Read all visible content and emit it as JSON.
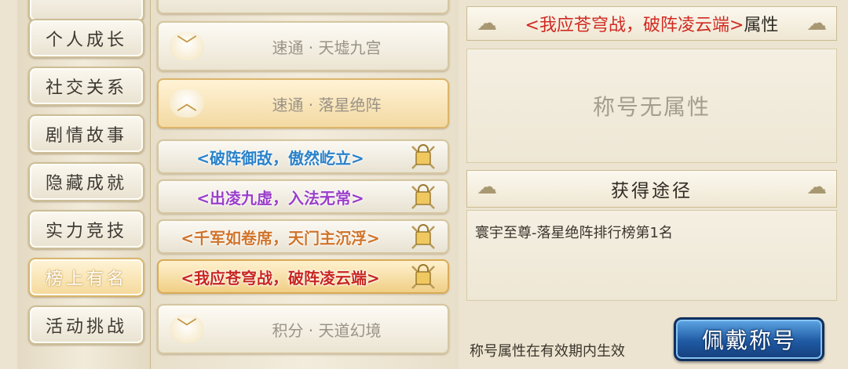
{
  "categories": [
    {
      "label": "个人成长",
      "active": false
    },
    {
      "label": "社交关系",
      "active": false
    },
    {
      "label": "剧情故事",
      "active": false
    },
    {
      "label": "隐藏成就",
      "active": false
    },
    {
      "label": "实力竞技",
      "active": false
    },
    {
      "label": "榜上有名",
      "active": true
    },
    {
      "label": "活动挑战",
      "active": false
    }
  ],
  "groups": [
    {
      "label": "速通 · 天墟九宫",
      "expanded": false
    },
    {
      "label": "速通 · 落星绝阵",
      "expanded": true
    },
    {
      "label": "积分 · 天道幻境",
      "expanded": false
    }
  ],
  "titles": [
    {
      "text": "<破阵御敌，傲然屹立>",
      "color": "#2a82c9",
      "selected": false
    },
    {
      "text": "<出凌九虚，入法无常>",
      "color": "#9b3fc9",
      "selected": false
    },
    {
      "text": "<千军如卷席，天门主沉浮>",
      "color": "#d0742a",
      "selected": false
    },
    {
      "text": "<我应苍穹战，破阵凌云端>",
      "color": "#c8261f",
      "selected": true
    }
  ],
  "detail": {
    "title_name": "<我应苍穹战，破阵凌云端>",
    "title_suffix": "属性",
    "title_name_color": "#d12a22",
    "no_attributes": "称号无属性",
    "obtain_header": "获得途径",
    "obtain_text": "寰宇至尊-落星绝阵排行榜第1名",
    "footer_note": "称号属性在有效期内生效",
    "wear_button": "佩戴称号"
  }
}
